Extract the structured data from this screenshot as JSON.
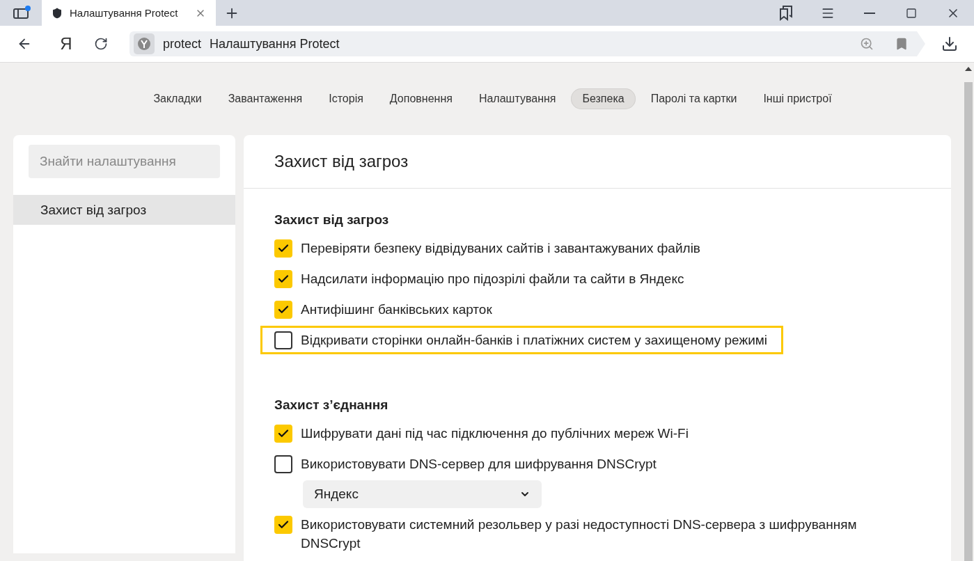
{
  "browser": {
    "tab": {
      "title": "Налаштування Protect",
      "selected": true
    },
    "sidebar_notification": true,
    "address": {
      "logo": "Я",
      "host": "protect",
      "title": "Налаштування Protect"
    }
  },
  "nav": [
    {
      "label": "Закладки",
      "selected": false
    },
    {
      "label": "Завантаження",
      "selected": false
    },
    {
      "label": "Історія",
      "selected": false
    },
    {
      "label": "Доповнення",
      "selected": false
    },
    {
      "label": "Налаштування",
      "selected": false
    },
    {
      "label": "Безпека",
      "selected": true
    },
    {
      "label": "Паролі та картки",
      "selected": false
    },
    {
      "label": "Інші пристрої",
      "selected": false
    }
  ],
  "sidebar": {
    "search": {
      "placeholder": "Знайти налаштування"
    },
    "items": [
      {
        "label": "Захист від загроз",
        "selected": true
      }
    ]
  },
  "panel": {
    "title": "Захист від загроз",
    "sections": [
      {
        "heading": "Захист від загроз",
        "options": [
          {
            "kind": "checkbox",
            "label": "Перевіряти безпеку відвідуваних сайтів і завантажуваних файлів",
            "checked": true,
            "highlighted": false
          },
          {
            "kind": "checkbox",
            "label": "Надсилати інформацію про підозрілі файли та сайти в Яндекс",
            "checked": true,
            "highlighted": false
          },
          {
            "kind": "checkbox",
            "label": "Антифішинг банківських карток",
            "checked": true,
            "highlighted": false
          },
          {
            "kind": "checkbox",
            "label": "Відкривати сторінки онлайн-банків і платіжних систем у захищеному режимі",
            "checked": false,
            "highlighted": true
          }
        ]
      },
      {
        "heading": "Захист з’єднання",
        "options": [
          {
            "kind": "checkbox",
            "label": "Шифрувати дані під час підключення до публічних мереж Wi-Fi",
            "checked": true,
            "highlighted": false
          },
          {
            "kind": "checkbox",
            "label": "Використовувати DNS-сервер для шифрування DNSCrypt",
            "checked": false,
            "highlighted": false
          },
          {
            "kind": "select",
            "value": "Яндекс"
          },
          {
            "kind": "checkbox",
            "label": "Використовувати системний резольвер у разі недоступності DNS-сервера з шифруванням DNSCrypt",
            "checked": true,
            "highlighted": false
          }
        ]
      }
    ]
  }
}
